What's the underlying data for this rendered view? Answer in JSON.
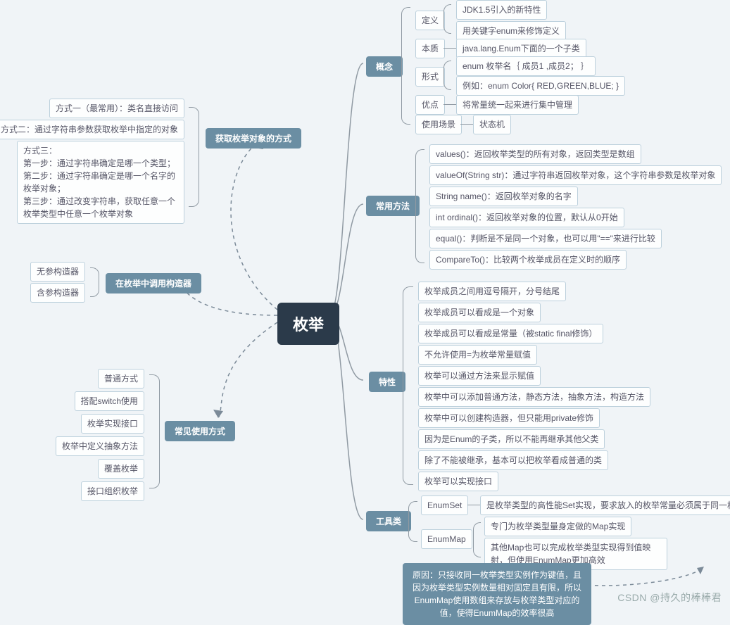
{
  "root": "枚举",
  "right": {
    "cat1": {
      "label": "概念",
      "sub": {
        "def": {
          "label": "定义",
          "items": [
            "JDK1.5引入的新特性",
            "用关键字enum来修饰定义"
          ]
        },
        "ess": {
          "label": "本质",
          "text": "java.lang.Enum下面的一个子类"
        },
        "form": {
          "label": "形式",
          "items": [
            "enum 枚举名｛   成员1 ,成员2；   ｝",
            "例如：enum Color{   RED,GREEN,BLUE;   }"
          ]
        },
        "adv": {
          "label": "优点",
          "text": "将常量统一起来进行集中管理"
        },
        "use": {
          "label": "使用场景",
          "text": "状态机"
        }
      }
    },
    "cat2": {
      "label": "常用方法",
      "items": [
        "values()：返回枚举类型的所有对象，返回类型是数组",
        "valueOf(String str)：通过字符串返回枚举对象，这个字符串参数是枚举对象",
        "String name()：返回枚举对象的名字",
        "int ordinal()：返回枚举对象的位置，默认从0开始",
        "equal()：判断是不是同一个对象，也可以用\"==\"来进行比较",
        "CompareTo()：比较两个枚举成员在定义时的顺序"
      ]
    },
    "cat3": {
      "label": "特性",
      "items": [
        "枚举成员之间用逗号隔开，分号结尾",
        "枚举成员可以看成是一个对象",
        "枚举成员可以看成是常量（被static final修饰）",
        "不允许使用=为枚举常量赋值",
        "枚举可以通过方法来显示赋值",
        "枚举中可以添加普通方法，静态方法，抽象方法，构造方法",
        "枚举中可以创建构造器，但只能用private修饰",
        "因为是Enum的子类，所以不能再继承其他父类",
        "除了不能被继承，基本可以把枚举看成普通的类",
        "枚举可以实现接口"
      ]
    },
    "cat4": {
      "label": "工具类",
      "sub": {
        "es": {
          "label": "EnumSet",
          "text": "是枚举类型的高性能Set实现，要求放入的枚举常量必须属于同一枚举类型"
        },
        "em": {
          "label": "EnumMap",
          "items": [
            "专门为枚举类型量身定做的Map实现",
            "其他Map也可以完成枚举类型实现得到值映射，但使用EnumMap更加高效"
          ],
          "note": "原因：只接收同一枚举类型实例作为键值，且因为枚举类型实例数量相对固定且有限，所以EnumMap使用数组来存放与枚举类型对应的值，使得EnumMap的效率很高"
        }
      }
    }
  },
  "left": {
    "top": {
      "label": "获取枚举对象的方式",
      "items": [
        "方式一（最常用）：类名直接访问",
        "方式二：通过字符串参数获取枚举中指定的对象",
        "方式三：\n第一步：通过字符串确定是哪一个类型；\n第二步：通过字符串确定是哪一个名字的枚举对象；\n第三步：通过改变字符串，获取任意一个枚举类型中任意一个枚举对象"
      ]
    },
    "mid": {
      "label": "在枚举中调用构造器",
      "items": [
        "无参构造器",
        "含参构造器"
      ]
    },
    "bot": {
      "label": "常见使用方式",
      "items": [
        "普通方式",
        "搭配switch使用",
        "枚举实现接口",
        "枚举中定义抽象方法",
        "覆盖枚举",
        "接口组织枚举"
      ]
    }
  },
  "watermark": "CSDN @持久的棒棒君"
}
